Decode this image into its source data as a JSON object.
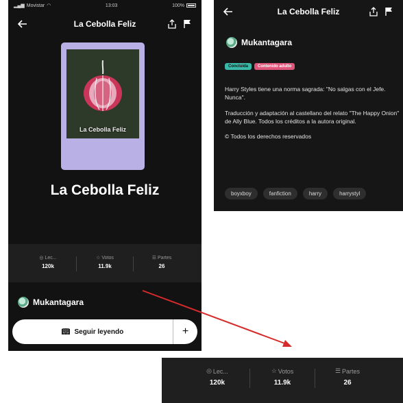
{
  "status": {
    "carrier": "Movistar",
    "time": "13:03",
    "battery": "100%"
  },
  "story": {
    "title": "La Cebolla Feliz",
    "cover_title": "La Cebolla Feliz",
    "author": "Mukantagara"
  },
  "stats": {
    "reads_label": "Lec...",
    "reads_value": "120k",
    "votes_label": "Votos",
    "votes_value": "11.9k",
    "parts_label": "Partes",
    "parts_value": "26"
  },
  "actions": {
    "continue_label": "Seguir leyendo",
    "add_label": "+"
  },
  "detail": {
    "badge_completed": "Concluida",
    "badge_adult": "Contenido adulto",
    "desc_1": "Harry Styles tiene una norma sagrada: \"No salgas con el Jefe. Nunca\".",
    "desc_2": "Traducción y adaptación al castellano del relato \"The Happy Onion\" de Ally Blue. Todos los créditos a la autora original.",
    "desc_3": "© Todos los derechos reservados",
    "tags": [
      "boyxboy",
      "fanfiction",
      "harry",
      "harrystyl"
    ]
  },
  "colors": {
    "background": "#121212",
    "cover_frame": "#b9b0e6",
    "badge_completed": "#3bb9a8",
    "badge_adult": "#e0567a",
    "arrow": "#d62b2b"
  },
  "icons": [
    "back-arrow-icon",
    "share-icon",
    "flag-icon",
    "eye-icon",
    "star-icon",
    "list-icon",
    "book-icon",
    "plus-icon"
  ]
}
